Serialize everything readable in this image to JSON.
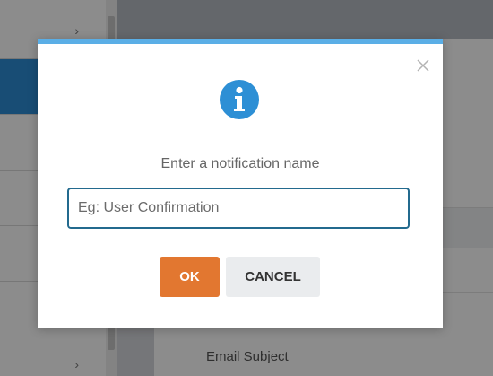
{
  "background": {
    "sidebar": {
      "rows": [
        {
          "chevron": "chevron-right-icon",
          "active": false
        },
        {
          "chevron": null,
          "active": true
        },
        {
          "chevron": null,
          "active": false
        },
        {
          "chevron": null,
          "active": false
        },
        {
          "chevron": null,
          "active": false
        },
        {
          "chevron": "chevron-right-icon",
          "active": false
        }
      ]
    },
    "panel": {
      "email_subject_label": "Email Subject"
    }
  },
  "modal": {
    "accent_color": "#5aaee6",
    "icon": "info-icon",
    "icon_color": "#2d8fd5",
    "prompt": "Enter a notification name",
    "input": {
      "value": "",
      "placeholder": "Eg: User Confirmation"
    },
    "buttons": {
      "ok_label": "OK",
      "ok_color": "#e27730",
      "cancel_label": "CANCEL"
    },
    "close_icon": "close-icon"
  }
}
